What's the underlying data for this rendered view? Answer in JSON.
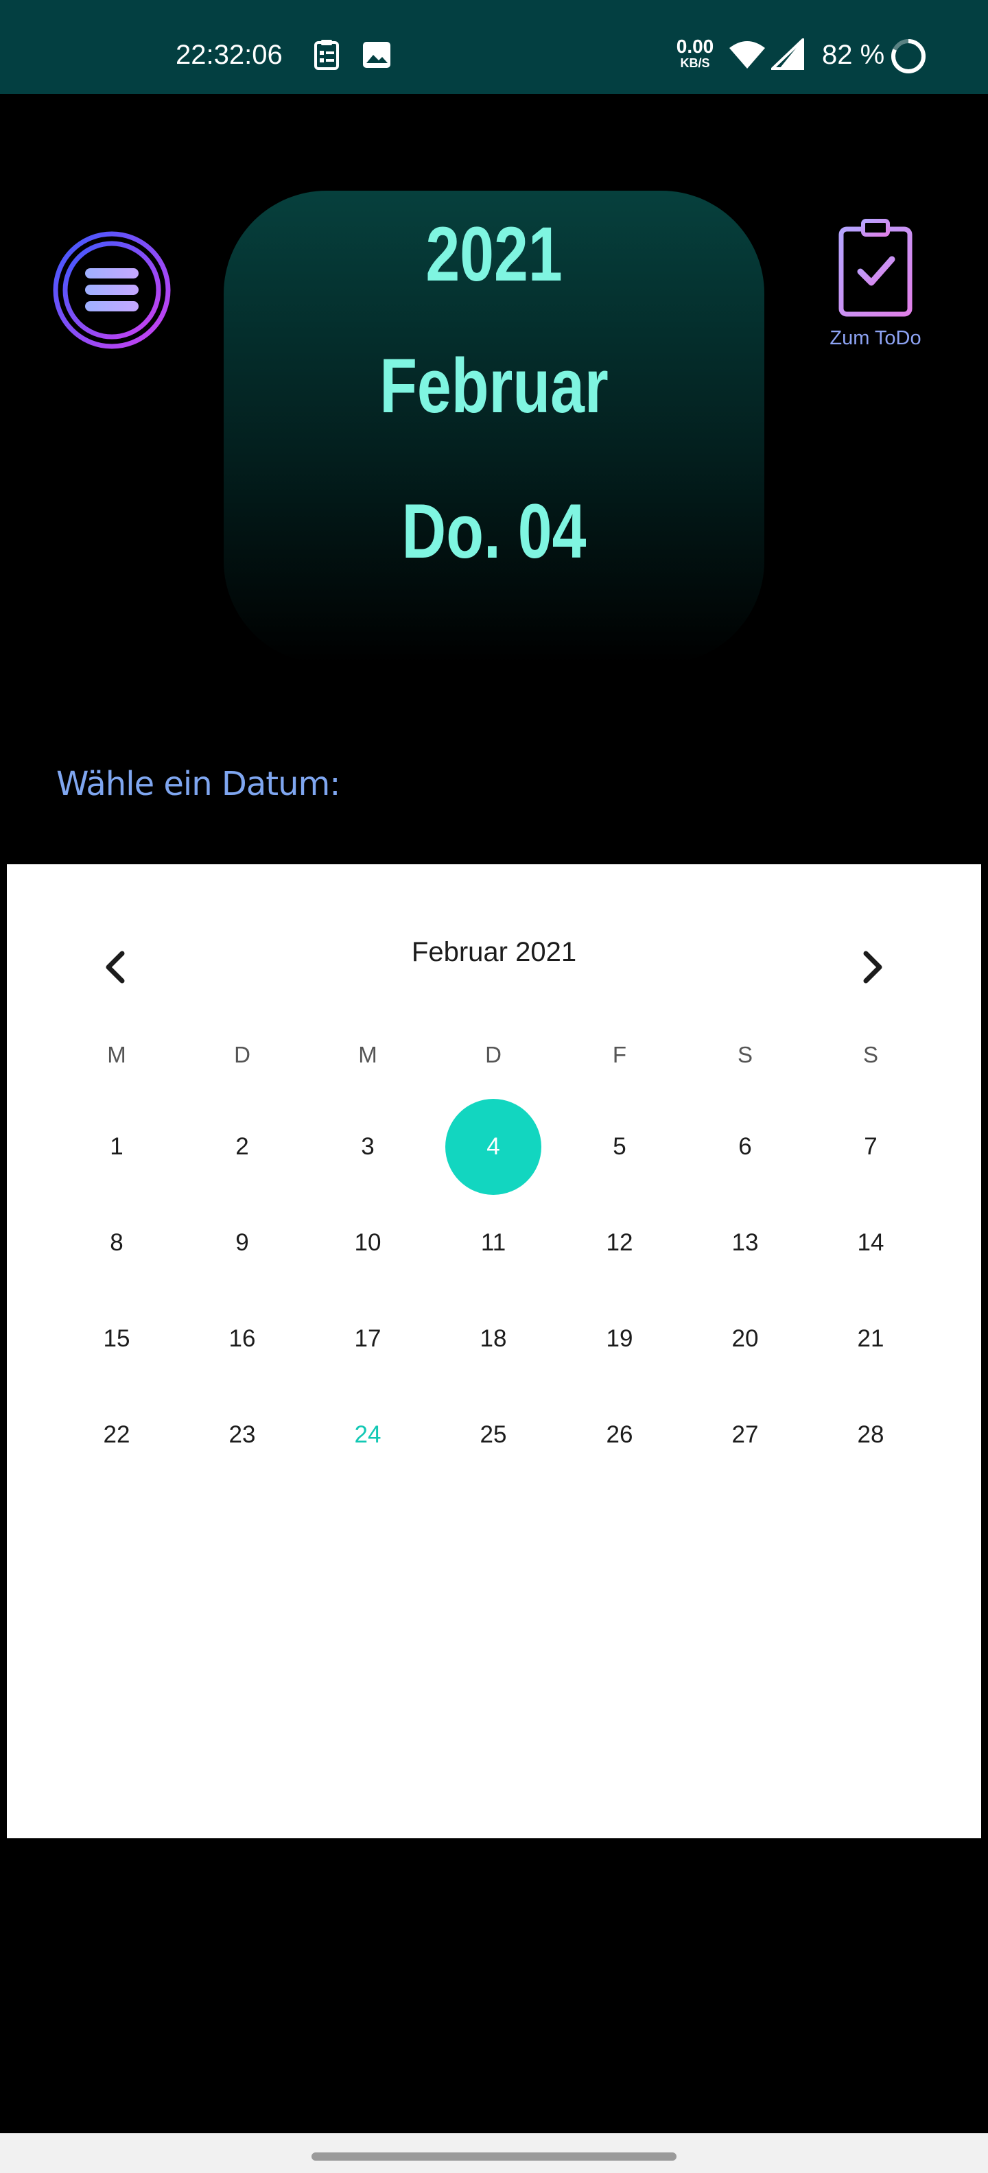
{
  "status_bar": {
    "time": "22:32:06",
    "net_speed_value": "0.00",
    "net_speed_unit": "KB/S",
    "battery_percent": "82 %",
    "battery_level": 0.82,
    "background": "#033f41",
    "icons": [
      "clipboard-notification-icon",
      "image-notification-icon",
      "wifi-icon",
      "cell-signal-icon",
      "battery-ring-icon"
    ]
  },
  "header": {
    "year": "2021",
    "month": "Februar",
    "day": "Do. 04",
    "accent": "#7ff5e1",
    "menu_icon": "menu-circle-icon",
    "todo_icon": "clipboard-check-icon",
    "todo_label": "Zum ToDo"
  },
  "prompt": "Wähle ein Datum:",
  "calendar": {
    "title": "Februar 2021",
    "prev_icon": "chevron-left-icon",
    "next_icon": "chevron-right-icon",
    "weekdays": [
      "M",
      "D",
      "M",
      "D",
      "F",
      "S",
      "S"
    ],
    "weeks": [
      [
        "1",
        "2",
        "3",
        "4",
        "5",
        "6",
        "7"
      ],
      [
        "8",
        "9",
        "10",
        "11",
        "12",
        "13",
        "14"
      ],
      [
        "15",
        "16",
        "17",
        "18",
        "19",
        "20",
        "21"
      ],
      [
        "22",
        "23",
        "24",
        "25",
        "26",
        "27",
        "28"
      ]
    ],
    "selected_day": "4",
    "today": "24",
    "selected_color": "#12d6c0",
    "today_color": "#12c8b4"
  }
}
